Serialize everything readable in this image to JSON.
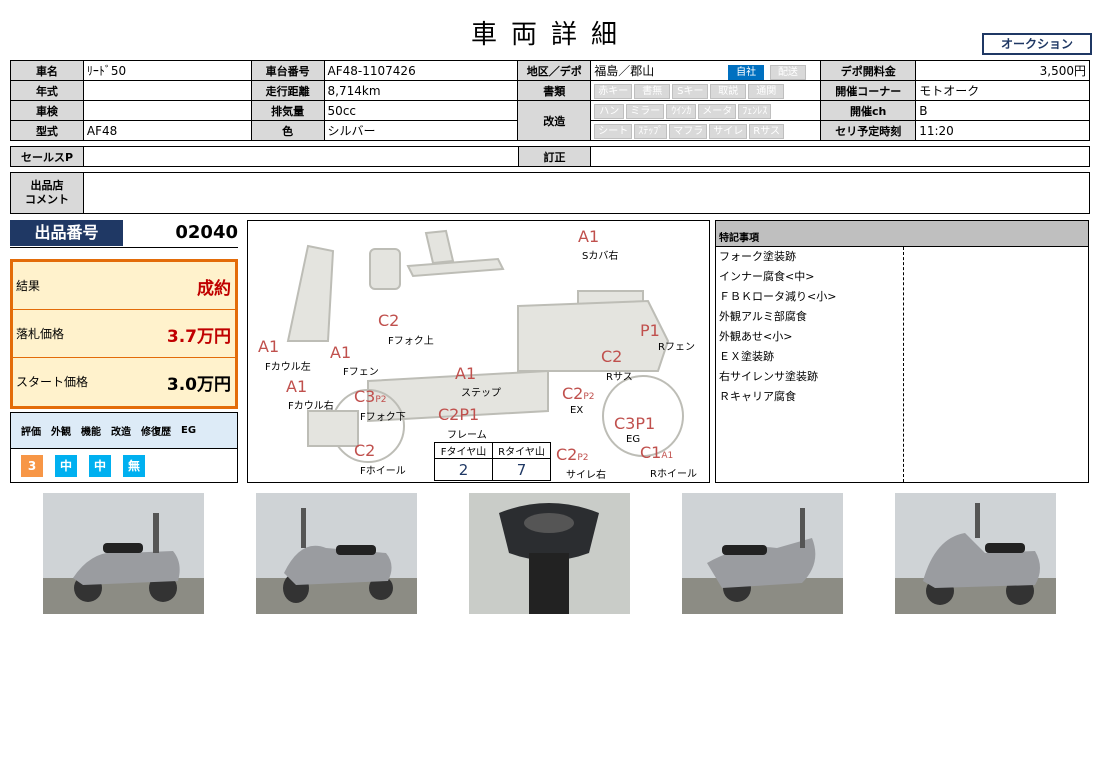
{
  "header": {
    "title": "車両詳細",
    "auction_button": "オークション"
  },
  "spec": {
    "row1": {
      "name_label": "車名",
      "name_value": "ﾘｰﾄﾞ50",
      "frame_label": "車台番号",
      "frame_value": "AF48-1107426",
      "area_label": "地区／デポ",
      "area_value": "福島／郡山",
      "own_chip": "自社",
      "delivery_chip": "配送",
      "fee_label": "デポ開料金",
      "fee_value": "3,500円"
    },
    "row2": {
      "year_label": "年式",
      "year_value": "",
      "mileage_label": "走行距離",
      "mileage_value": "8,714km",
      "docs_label": "書類",
      "docs_chips": [
        "赤キー",
        "書無",
        "Sキー",
        "取説",
        "通関"
      ],
      "corner_label": "開催コーナー",
      "corner_value": "モトオーク"
    },
    "row3": {
      "inspection_label": "車検",
      "inspection_value": "",
      "displacement_label": "排気量",
      "displacement_value": "50cc",
      "mod_label": "改造",
      "mod_chips_1": [
        "ハン",
        "ミラー",
        "ｳｲﾝｶ",
        "メータ",
        "ﾌｪﾝﾚｽ"
      ],
      "ch_label": "開催ch",
      "ch_value": "B"
    },
    "row4": {
      "model_label": "型式",
      "model_value": "AF48",
      "color_label": "色",
      "color_value": "シルバー",
      "mod_chips_2": [
        "シート",
        "ｽﾃｯﾌﾟ",
        "マフラ",
        "サイレ",
        "Rサス"
      ],
      "time_label": "セリ予定時刻",
      "time_value": "11:20"
    },
    "salespoint_label": "セールスP",
    "salespoint_value": "",
    "correction_label": "訂正",
    "correction_value": "",
    "comment_label_1": "出品店",
    "comment_label_2": "コメント",
    "comment_value": ""
  },
  "lot": {
    "label": "出品番号",
    "number": "02040"
  },
  "result": {
    "rows": [
      {
        "key": "結果",
        "value": "成約"
      },
      {
        "key": "落札価格",
        "value": "3.7万円"
      },
      {
        "key": "スタート価格",
        "value": "3.0万円"
      }
    ]
  },
  "evaluation": {
    "headers": [
      "評価",
      "外観",
      "機能",
      "改造",
      "修復歴",
      "EG"
    ],
    "values": [
      "3",
      "中",
      "中",
      "無"
    ]
  },
  "diagram": {
    "labels": {
      "s_cover_r": "Sカバ右",
      "f_fork_up": "Fフォク上",
      "r_fender": "Rフェン",
      "f_cowl_l": "Fカウル左",
      "f_fender": "Fフェン",
      "r_sus": "Rサス",
      "step": "ステップ",
      "f_cowl_r": "Fカウル右",
      "f_fork_down": "Fフォク下",
      "frame": "フレーム",
      "ex": "EX",
      "eg": "EG",
      "f_wheel": "Fホイール",
      "silencer_r": "サイレ右",
      "r_wheel": "Rホイール"
    },
    "codes": {
      "s_cover_r": "A1",
      "f_fork_up": "C2",
      "r_fender": "P1",
      "f_cowl_l": "A1",
      "f_fender": "A1",
      "r_sus": "C2",
      "step": "A1",
      "f_cowl_r": "A1",
      "f_fork_down": "C3",
      "f_fork_down_sub": "P2",
      "frame": "C2",
      "frame_2": "P1",
      "ex": "C2",
      "ex_sub": "P2",
      "eg": "C3",
      "eg_2": "P1",
      "f_wheel": "C2",
      "silencer_r": "C2",
      "silencer_r_sub": "P2",
      "r_wheel": "C1",
      "r_wheel_sub": "A1"
    },
    "tires": {
      "front_label": "Fタイヤ山",
      "rear_label": "Rタイヤ山",
      "front_value": "2",
      "rear_value": "7"
    }
  },
  "notes": {
    "header": "特記事項",
    "items": [
      "フォーク塗装跡",
      "インナー腐食<中>",
      "ＦＢＫロータ減り<小>",
      "外観アルミ部腐食",
      "外観あせ<小>",
      "ＥＸ塗装跡",
      "右サイレンサ塗装跡",
      "Ｒキャリア腐食"
    ]
  }
}
